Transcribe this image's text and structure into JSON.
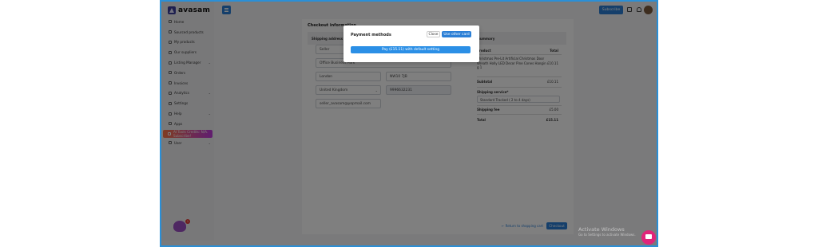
{
  "brand": {
    "name": "avasam"
  },
  "sidebar": {
    "items": [
      {
        "label": "Home",
        "icon": "home-icon"
      },
      {
        "label": "Sourced products",
        "icon": "box-icon"
      },
      {
        "label": "My products",
        "icon": "tag-icon"
      },
      {
        "label": "Our suppliers",
        "icon": "users-icon"
      },
      {
        "label": "Listing Manager",
        "icon": "list-icon",
        "caret": "⌄"
      },
      {
        "label": "Orders",
        "icon": "cart-icon"
      },
      {
        "label": "Invoices",
        "icon": "file-icon"
      },
      {
        "label": "Analytics",
        "icon": "chart-icon",
        "caret": "⌄"
      },
      {
        "label": "Settings",
        "icon": "gear-icon"
      },
      {
        "label": "Help",
        "icon": "help-icon",
        "caret": "⌄"
      },
      {
        "label": "Apps",
        "icon": "apps-icon"
      }
    ],
    "upgrade_label": "AI Tools Credits: N/A. Subscribe!",
    "user_label": "User",
    "user_caret": "⌄",
    "mascot_badge": "1"
  },
  "header": {
    "subscribe_label": "Subscribe",
    "icons": [
      "cart-icon",
      "bell-icon"
    ]
  },
  "checkout": {
    "title": "Checkout information",
    "shipping_header": "Shipping address",
    "summary_header": "Summary",
    "fields": {
      "first_name": "Seller",
      "address": "Office Business Park",
      "city": "London",
      "postcode": "NW10 7JB",
      "country": "United Kingdom",
      "phone": "9996632231",
      "email": "seller_avasam@yopmail.com"
    },
    "summary": {
      "product_header": "Product",
      "total_header": "Total",
      "product_name": "Christmas Pre-Lit Artificial Christmas Door Wreath Holly LED Decor Pine Cones Hangin g 1",
      "product_total": "£10.11",
      "subtotal_label": "Subtotal",
      "subtotal_value": "£10.11",
      "shipping_service_label": "Shipping service*",
      "shipping_service_value": "Standard Tracked ( 2 to 4 days)",
      "shipping_fee_label": "Shipping fee",
      "shipping_fee_value": "£5.00",
      "total_label": "Total",
      "total_value": "£15.11"
    },
    "back_link": "← Return to shopping cart",
    "checkout_button": "Checkout"
  },
  "modal": {
    "title": "Payment methods",
    "close_label": "Close",
    "other_card_label": "Use other card",
    "pay_label": "Pay (£15.11) with default setting"
  },
  "watermark": {
    "line1": "Activate Windows",
    "line2": "Go to Settings to activate Windows."
  },
  "colors": {
    "accent": "#2b7fd6",
    "frame_border": "#2b8fd6",
    "chat_bubble": "#e0247a"
  }
}
